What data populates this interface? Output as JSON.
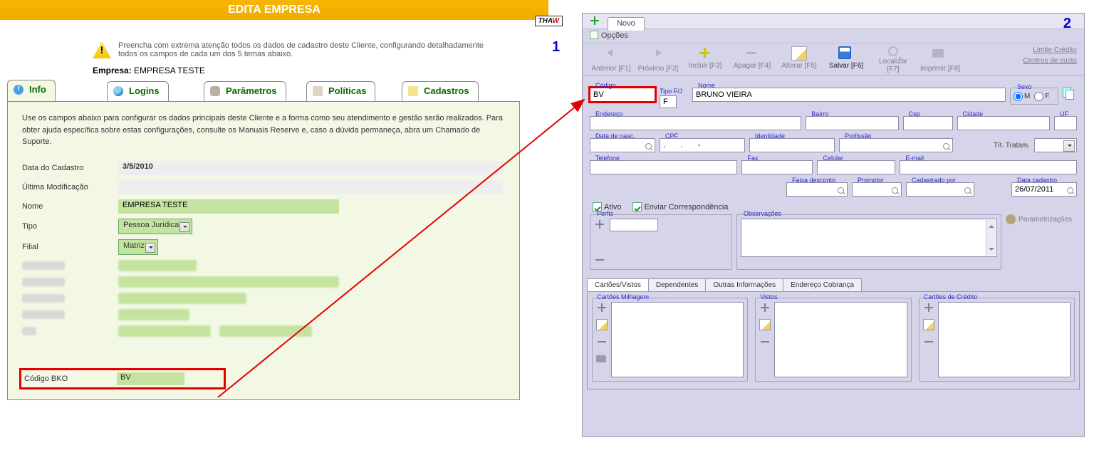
{
  "left": {
    "title": "EDITA EMPRESA",
    "badge": "THAW",
    "warning_text": "Preencha com extrema atenção todos os dados de cadastro deste Cliente, configurando detalhadamente todos os campos de cada um dos 5 temas abaixo.",
    "empresa_label": "Empresa:",
    "empresa_value": "EMPRESA TESTE",
    "tabs": {
      "info": "Info",
      "logins": "Logins",
      "parametros": "Parâmetros",
      "politicas": "Políticas",
      "cadastros": "Cadastros"
    },
    "intro": "Use os campos abaixo para configurar os dados principais deste Cliente e a forma como seu atendimento e gestão serão realizados. Para obter ajuda específica sobre estas configurações, consulte os Manuais Reserve e, caso a dúvida permaneça, abra um Chamado de Suporte.",
    "form": {
      "data_cadastro_label": "Data do Cadastro",
      "data_cadastro_value": "3/5/2010",
      "ultima_modificacao_label": "Última Modificação",
      "ultima_modificacao_value": "",
      "nome_label": "Nome",
      "nome_value": "EMPRESA TESTE",
      "tipo_label": "Tipo",
      "tipo_value": "Pessoa Jurídica",
      "filial_label": "Filial",
      "filial_value": "Matriz",
      "codigo_bko_label": "Código BKO",
      "codigo_bko_value": "BV"
    },
    "num": "1"
  },
  "right": {
    "novo_tab": "Novo",
    "options": "Opções",
    "num": "2",
    "toolbar": {
      "anterior": "Anterior [F1]",
      "proximo": "Próximo [F2]",
      "incluir": "Incluir [F3]",
      "apagar": "Apagar [F4]",
      "alterar": "Alterar [F5]",
      "salvar": "Salvar [F6]",
      "localizar": "Localizar [F7]",
      "imprimir": "Imprimir [F8]",
      "limite_credito": "Limite Crédito",
      "centros_custo": "Centros de custo"
    },
    "fields": {
      "codigo_label": "Código",
      "codigo_value": "BV",
      "tipo_fj_label": "Tipo F/J",
      "tipo_fj_value": "F",
      "nome_label": "Nome",
      "nome_value": "BRUNO VIEIRA",
      "sexo_label": "Sexo",
      "sexo_m": "M",
      "sexo_f": "F",
      "endereco": "Endereço",
      "bairro": "Bairro",
      "cep": "Cep",
      "cidade": "Cidade",
      "uf": "UF",
      "data_nasc": "Data de nasc.",
      "cpf": "CPF",
      "cpf_value": ".       .       -",
      "identidade": "Identidade",
      "profissao": "Profissão",
      "tit_tratam": "Tít. Tratam.",
      "telefone": "Telefone",
      "fax": "Fax",
      "celular": "Celular",
      "email": "E-mail",
      "faixa_desconto": "Faixa desconto",
      "promotor": "Promotor",
      "cadastrado_por": "Cadastrado por",
      "data_cadastro": "Data cadastro",
      "data_cadastro_value": "26/07/2011",
      "ativo": "Ativo",
      "enviar_corresp": "Enviar Correspondência",
      "perfis": "Perfis",
      "observacoes": "Observações",
      "parametrizacoes": "Parametrizações"
    },
    "bottom_tabs": {
      "cartoes_vistos": "Cartões/Vistos",
      "dependentes": "Dependentes",
      "outras_info": "Outras Informações",
      "endereco_cobranca": "Endereço Cobrança"
    },
    "sub": {
      "cartoes_milhagem": "Cartões Milhagem",
      "vistos": "Vistos",
      "cartoes_credito": "Cartões de Crédito"
    }
  }
}
